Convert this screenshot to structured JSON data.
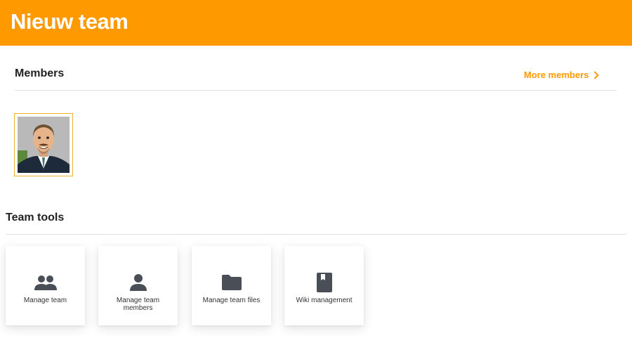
{
  "header": {
    "title": "Nieuw team"
  },
  "members": {
    "title": "Members",
    "more_label": "More members",
    "avatars": [
      {
        "name": "avatar"
      }
    ]
  },
  "team_tools": {
    "title": "Team tools",
    "tools": [
      {
        "label": "Manage team",
        "icon": "group-icon"
      },
      {
        "label": "Manage team members",
        "icon": "person-icon"
      },
      {
        "label": "Manage team files",
        "icon": "folder-icon"
      },
      {
        "label": "Wiki management",
        "icon": "book-icon"
      }
    ]
  },
  "colors": {
    "accent": "#ff9900",
    "icon": "#4a4e57",
    "avatar_border": "#f0b22e"
  }
}
